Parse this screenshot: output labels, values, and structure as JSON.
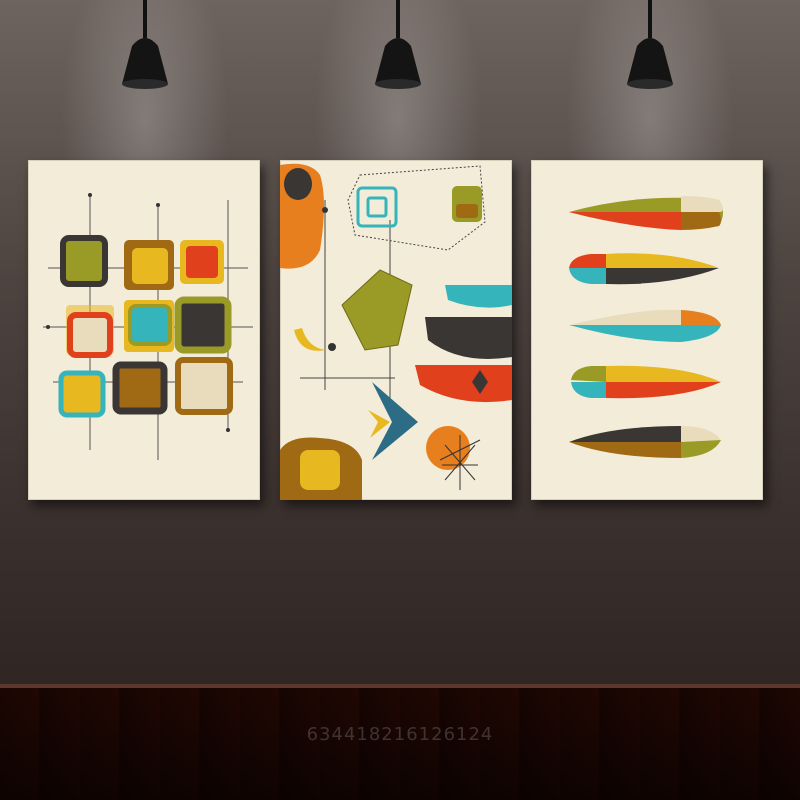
{
  "watermark": {
    "text": "634418216126124"
  },
  "colors": {
    "canvas": "#f3ecd9",
    "olive": "#9a9a26",
    "mustard": "#e8b820",
    "orange": "#e87f1e",
    "red": "#e0401c",
    "teal": "#36b4bb",
    "charcoal": "#3a3634",
    "brown": "#a06a14",
    "beige": "#e8dcbc"
  },
  "panels": [
    "left-panel",
    "middle-panel",
    "right-panel"
  ]
}
